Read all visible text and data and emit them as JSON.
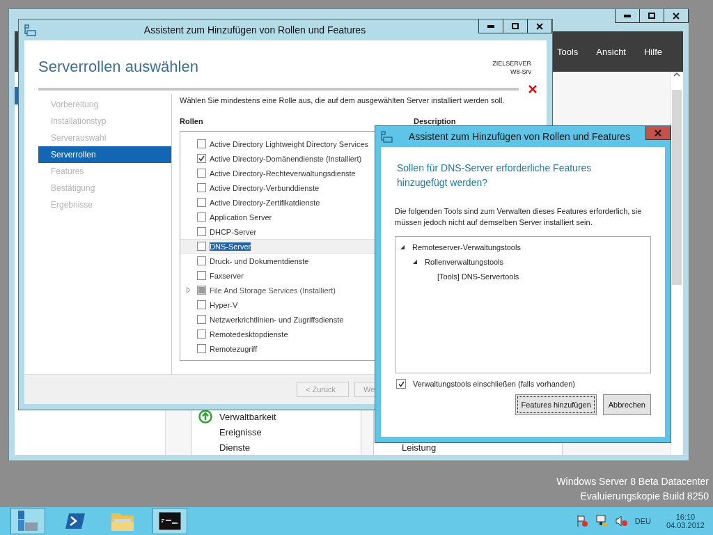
{
  "server_manager": {
    "menu": [
      "Tools",
      "Ansicht",
      "Hilfe"
    ],
    "tiles": [
      {
        "items": [
          {
            "label": "Verwaltbarkeit",
            "kind": "status"
          },
          {
            "label": "Ereignisse",
            "kind": "plain"
          },
          {
            "label": "Dienste",
            "kind": "plain"
          }
        ]
      },
      {
        "items": [
          {
            "label": "Leistung",
            "kind": "plain"
          }
        ]
      }
    ]
  },
  "wizard": {
    "title": "Assistent zum Hinzufügen von Rollen und Features",
    "heading": "Serverrollen auswählen",
    "target_label": "ZIELSERVER",
    "target_server": "W8-Srv",
    "steps": [
      {
        "label": "Vorbereitung",
        "selected": false
      },
      {
        "label": "Installationstyp",
        "selected": false
      },
      {
        "label": "Serverauswahl",
        "selected": false
      },
      {
        "label": "Serverrollen",
        "selected": true
      },
      {
        "label": "Features",
        "selected": false
      },
      {
        "label": "Bestätigung",
        "selected": false
      },
      {
        "label": "Ergebnisse",
        "selected": false
      }
    ],
    "instruction": "Wählen Sie mindestens eine Rolle aus, die auf dem ausgewählten Server installiert werden soll.",
    "roles_heading": "Rollen",
    "description_heading": "Description",
    "roles": [
      {
        "label": "Active Directory Lightweight Directory Services",
        "checked": false,
        "disabled": false,
        "expandable": false,
        "selected": false
      },
      {
        "label": "Active Directory-Domänendienste (Installiert)",
        "checked": true,
        "disabled": false,
        "expandable": false,
        "selected": false
      },
      {
        "label": "Active Directory-Rechteverwaltungsdienste",
        "checked": false,
        "disabled": false,
        "expandable": false,
        "selected": false
      },
      {
        "label": "Active Directory-Verbunddienste",
        "checked": false,
        "disabled": false,
        "expandable": false,
        "selected": false
      },
      {
        "label": "Active Directory-Zertifikatdienste",
        "checked": false,
        "disabled": false,
        "expandable": false,
        "selected": false
      },
      {
        "label": "Application Server",
        "checked": false,
        "disabled": false,
        "expandable": false,
        "selected": false
      },
      {
        "label": "DHCP-Server",
        "checked": false,
        "disabled": false,
        "expandable": false,
        "selected": false
      },
      {
        "label": "DNS-Server",
        "checked": false,
        "disabled": false,
        "expandable": false,
        "selected": true
      },
      {
        "label": "Druck- und Dokumentdienste",
        "checked": false,
        "disabled": false,
        "expandable": false,
        "selected": false
      },
      {
        "label": "Faxserver",
        "checked": false,
        "disabled": false,
        "expandable": false,
        "selected": false
      },
      {
        "label": "File And Storage Services (Installiert)",
        "checked": true,
        "disabled": true,
        "expandable": true,
        "selected": false
      },
      {
        "label": "Hyper-V",
        "checked": false,
        "disabled": false,
        "expandable": false,
        "selected": false
      },
      {
        "label": "Netzwerkrichtlinien- und Zugriffsdienste",
        "checked": false,
        "disabled": false,
        "expandable": false,
        "selected": false
      },
      {
        "label": "Remotedesktopdienste",
        "checked": false,
        "disabled": false,
        "expandable": false,
        "selected": false
      },
      {
        "label": "Remotezugriff",
        "checked": false,
        "disabled": false,
        "expandable": false,
        "selected": false
      }
    ],
    "buttons": [
      {
        "label": "< Zurück",
        "disabled": true
      },
      {
        "label": "We",
        "disabled": true
      }
    ]
  },
  "dialog": {
    "title": "Assistent zum Hinzufügen von Rollen und Features",
    "heading": "Sollen für DNS-Server erforderliche Features hinzugefügt werden?",
    "text": "Die folgenden Tools sind zum Verwalten dieses Features erforderlich, sie müssen jedoch nicht auf demselben Server installiert sein.",
    "tree": [
      {
        "label": "Remoteserver-Verwaltungstools",
        "expanded": true,
        "children": [
          {
            "label": "Rollenverwaltungstools",
            "expanded": true,
            "children": [
              {
                "label": "[Tools] DNS-Servertools"
              }
            ]
          }
        ]
      }
    ],
    "include_tools": {
      "label": "Verwaltungstools einschließen (falls vorhanden)",
      "checked": true
    },
    "buttons": [
      {
        "label": "Features hinzufügen",
        "focused": true
      },
      {
        "label": "Abbrechen",
        "focused": false
      }
    ]
  },
  "desktop": {
    "edition_lines": [
      "Windows Server 8 Beta Datacenter",
      "Evaluierungskopie Build 8250"
    ]
  },
  "taskbar": {
    "apps": [
      {
        "kind": "server-manager",
        "active": true
      },
      {
        "kind": "powershell",
        "active": false
      },
      {
        "kind": "explorer",
        "active": false
      },
      {
        "kind": "console",
        "active": true
      }
    ],
    "language": "DEU",
    "time": "16:10",
    "date": "04.03.2012"
  }
}
